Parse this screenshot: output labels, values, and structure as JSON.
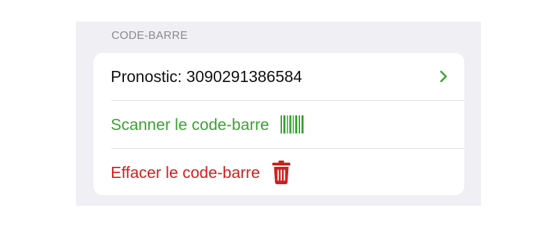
{
  "section": {
    "header": "CODE-BARRE"
  },
  "rows": [
    {
      "label": "Pronostic: 3090291386584",
      "icon": "chevron-right-icon"
    },
    {
      "label": "Scanner le code-barre",
      "icon": "barcode-icon"
    },
    {
      "label": "Effacer le code-barre",
      "icon": "trash-icon"
    }
  ],
  "colors": {
    "background": "#efeff4",
    "card": "#ffffff",
    "header_text": "#8a8a8e",
    "accent_green": "#3aa532",
    "destructive_red": "#d21e1e"
  }
}
